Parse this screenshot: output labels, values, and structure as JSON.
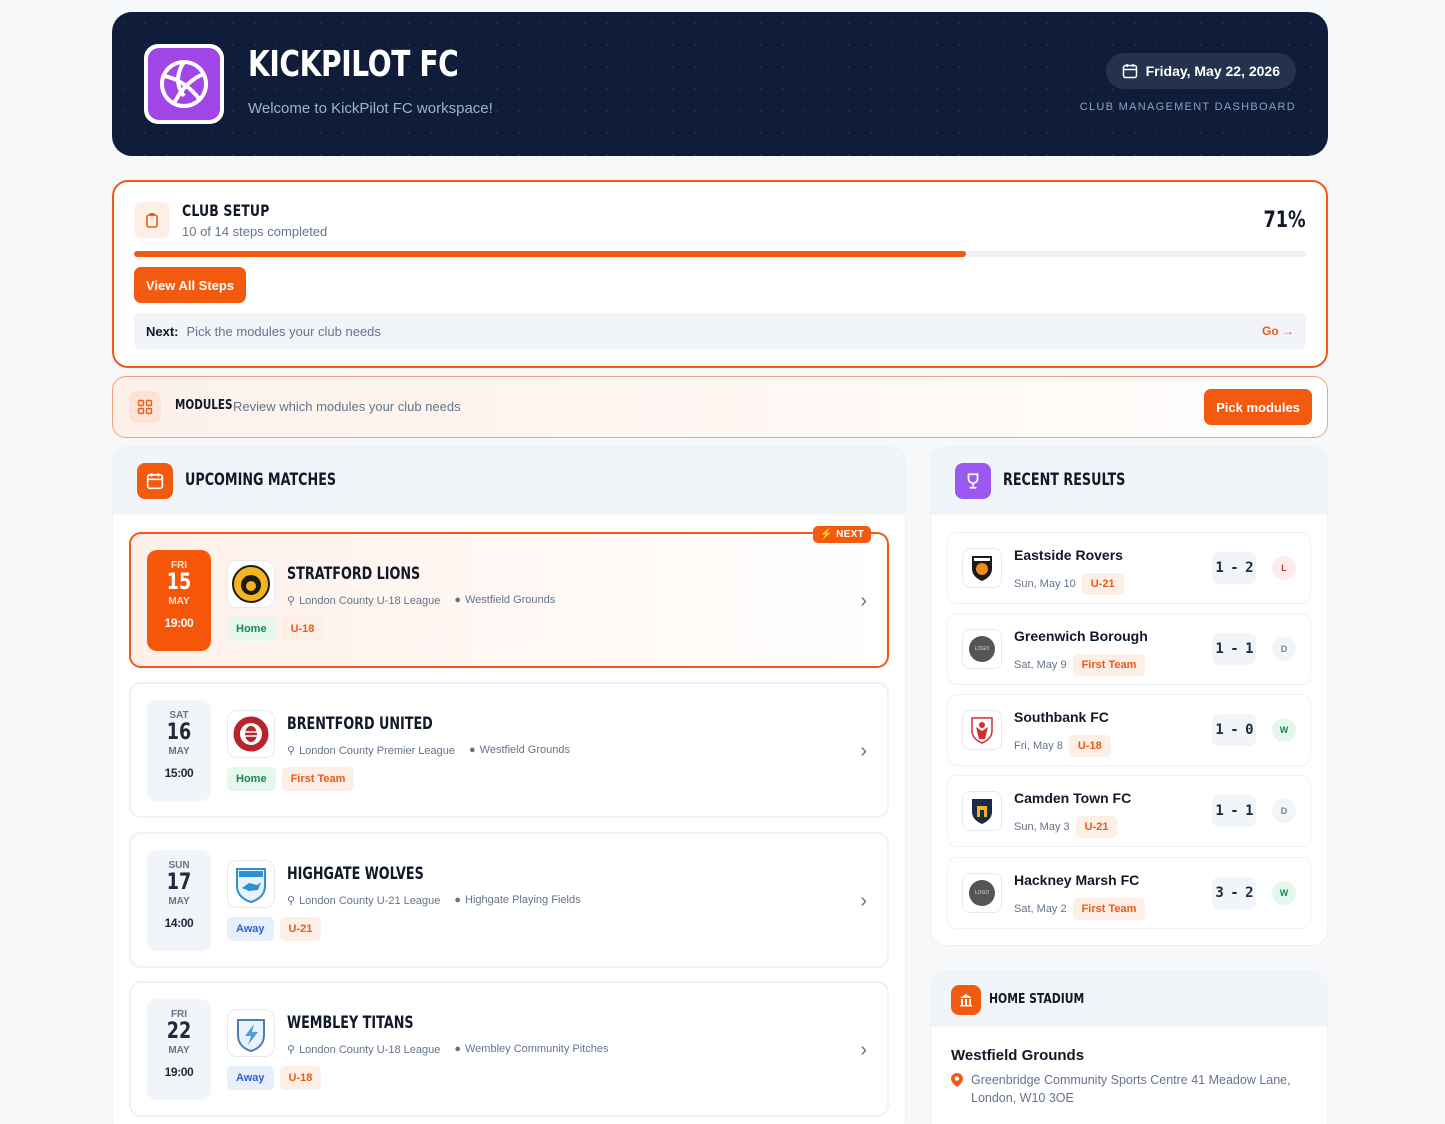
{
  "header": {
    "title": "KICKPILOT FC",
    "subtitle": "Welcome to KickPilot FC workspace!",
    "date": "Friday, May 22, 2026",
    "caption": "CLUB MANAGEMENT DASHBOARD"
  },
  "setup": {
    "title": "CLUB SETUP",
    "subtitle": "10 of 14 steps completed",
    "percent_label": "71%",
    "progress": 0.71,
    "button": "View All Steps",
    "next_label": "Next:",
    "next_text": "Pick the modules your club needs",
    "go": "Go →"
  },
  "modules": {
    "title": "MODULES",
    "desc": "Review which modules your club needs",
    "button": "Pick modules"
  },
  "upcoming": {
    "title": "UPCOMING MATCHES",
    "next_badge": "⚡ NEXT",
    "matches": [
      {
        "dow": "FRI",
        "day": "15",
        "mon": "MAY",
        "time": "19:00",
        "name": "STRATFORD LIONS",
        "league": "London County U-18 League",
        "venue": "Westfield Grounds",
        "side": "Home",
        "team": "U-18",
        "crest": "lion-crest-icon"
      },
      {
        "dow": "SAT",
        "day": "16",
        "mon": "MAY",
        "time": "15:00",
        "name": "BRENTFORD UNITED",
        "league": "London County Premier League",
        "venue": "Westfield Grounds",
        "side": "Home",
        "team": "First Team",
        "crest": "bee-crest-icon"
      },
      {
        "dow": "SUN",
        "day": "17",
        "mon": "MAY",
        "time": "14:00",
        "name": "HIGHGATE WOLVES",
        "league": "London County U-21 League",
        "venue": "Highgate Playing Fields",
        "side": "Away",
        "team": "U-21",
        "crest": "wolf-crest-icon"
      },
      {
        "dow": "FRI",
        "day": "22",
        "mon": "MAY",
        "time": "19:00",
        "name": "WEMBLEY TITANS",
        "league": "London County U-18 League",
        "venue": "Wembley Community Pitches",
        "side": "Away",
        "team": "U-18",
        "crest": "lightning-crest-icon"
      }
    ]
  },
  "results": {
    "title": "RECENT RESULTS",
    "items": [
      {
        "name": "Eastside Rovers",
        "date": "Sun, May 10",
        "team": "U-21",
        "score": "1 - 2",
        "outcome": "L"
      },
      {
        "name": "Greenwich Borough",
        "date": "Sat, May 9",
        "team": "First Team",
        "score": "1 - 1",
        "outcome": "D",
        "logo_text": "LOGO"
      },
      {
        "name": "Southbank FC",
        "date": "Fri, May 8",
        "team": "U-18",
        "score": "1 - 0",
        "outcome": "W"
      },
      {
        "name": "Camden Town FC",
        "date": "Sun, May 3",
        "team": "U-21",
        "score": "1 - 1",
        "outcome": "D"
      },
      {
        "name": "Hackney Marsh FC",
        "date": "Sat, May 2",
        "team": "First Team",
        "score": "3 - 2",
        "outcome": "W",
        "logo_text": "LOGO"
      }
    ]
  },
  "stadium": {
    "title": "HOME STADIUM",
    "name": "Westfield Grounds",
    "address": "Greenbridge Community Sports Centre 41 Meadow Lane, London, W10 3OE"
  },
  "colors": {
    "accent": "#f05a16",
    "navy": "#0f1d3a",
    "purple": "#a145e6"
  }
}
